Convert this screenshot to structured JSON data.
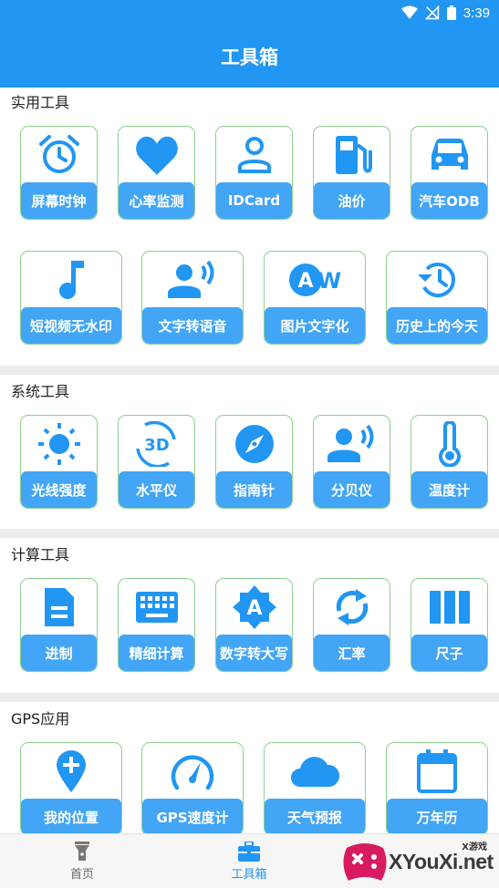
{
  "status": {
    "time": "3:39"
  },
  "header": {
    "title": "工具箱"
  },
  "sections": [
    {
      "title": "实用工具",
      "items": [
        {
          "label": "屏幕时钟",
          "icon": "alarm-clock-icon"
        },
        {
          "label": "心率监测",
          "icon": "heart-icon"
        },
        {
          "label": "IDCard",
          "icon": "person-icon"
        },
        {
          "label": "油价",
          "icon": "gas-station-icon"
        },
        {
          "label": "汽车ODB",
          "icon": "car-icon"
        },
        {
          "label": "短视频无水印",
          "icon": "music-note-icon"
        },
        {
          "label": "文字转语音",
          "icon": "voice-icon"
        },
        {
          "label": "图片文字化",
          "icon": "text-recognition-icon"
        },
        {
          "label": "历史上的今天",
          "icon": "history-icon"
        }
      ]
    },
    {
      "title": "系统工具",
      "items": [
        {
          "label": "光线强度",
          "icon": "sun-icon"
        },
        {
          "label": "水平仪",
          "icon": "3d-rotation-icon"
        },
        {
          "label": "指南针",
          "icon": "compass-icon"
        },
        {
          "label": "分贝仪",
          "icon": "voice-icon"
        },
        {
          "label": "温度计",
          "icon": "thermometer-icon"
        }
      ]
    },
    {
      "title": "计算工具",
      "items": [
        {
          "label": "进制",
          "icon": "document-icon"
        },
        {
          "label": "精细计算",
          "icon": "keyboard-icon"
        },
        {
          "label": "数字转大写",
          "icon": "font-a-icon"
        },
        {
          "label": "汇率",
          "icon": "refresh-icon"
        },
        {
          "label": "尺子",
          "icon": "columns-icon"
        }
      ]
    },
    {
      "title": "GPS应用",
      "items": [
        {
          "label": "我的位置",
          "icon": "add-location-icon"
        },
        {
          "label": "GPS速度计",
          "icon": "speedometer-icon"
        },
        {
          "label": "天气预报",
          "icon": "cloud-icon"
        },
        {
          "label": "万年历",
          "icon": "calendar-icon"
        }
      ]
    }
  ],
  "bottom_nav": [
    {
      "label": "首页",
      "icon": "flashlight-icon",
      "active": false
    },
    {
      "label": "工具箱",
      "icon": "toolbox-icon",
      "active": true
    }
  ],
  "watermark": {
    "text": "XYouXi.net",
    "small": "X游戏"
  },
  "colors": {
    "primary": "#2196f3",
    "tile_label": "#42a5f5",
    "tile_border": "#8bd08f"
  }
}
